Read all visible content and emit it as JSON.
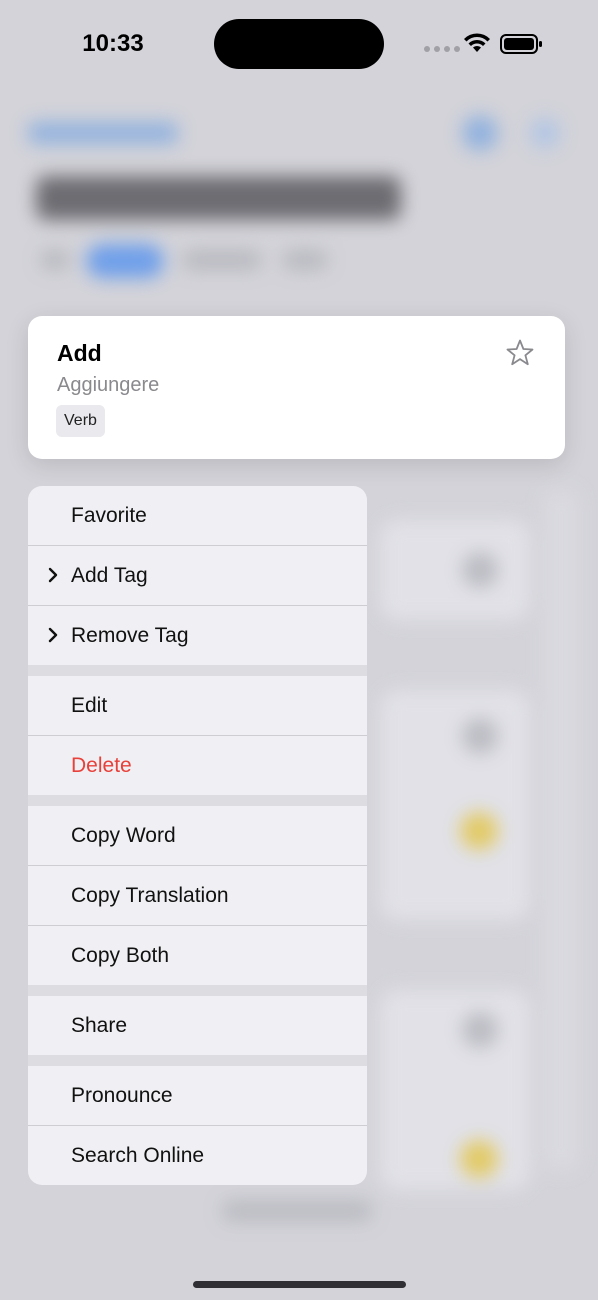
{
  "status_bar": {
    "time": "10:33"
  },
  "preview_card": {
    "word": "Add",
    "translation": "Aggiungere",
    "tag": "Verb",
    "favorite_icon": "star-outline-icon"
  },
  "context_menu": {
    "items": [
      {
        "label": "Favorite",
        "has_submenu": false,
        "destructive": false
      },
      {
        "label": "Add Tag",
        "has_submenu": true,
        "destructive": false
      },
      {
        "label": "Remove Tag",
        "has_submenu": true,
        "destructive": false
      },
      {
        "label": "Edit",
        "has_submenu": false,
        "destructive": false
      },
      {
        "label": "Delete",
        "has_submenu": false,
        "destructive": true
      },
      {
        "label": "Copy Word",
        "has_submenu": false,
        "destructive": false
      },
      {
        "label": "Copy Translation",
        "has_submenu": false,
        "destructive": false
      },
      {
        "label": "Copy Both",
        "has_submenu": false,
        "destructive": false
      },
      {
        "label": "Share",
        "has_submenu": false,
        "destructive": false
      },
      {
        "label": "Pronounce",
        "has_submenu": false,
        "destructive": false
      },
      {
        "label": "Search Online",
        "has_submenu": false,
        "destructive": false
      }
    ]
  },
  "colors": {
    "destructive": "#e8403a",
    "accent": "#4e8ef0"
  }
}
